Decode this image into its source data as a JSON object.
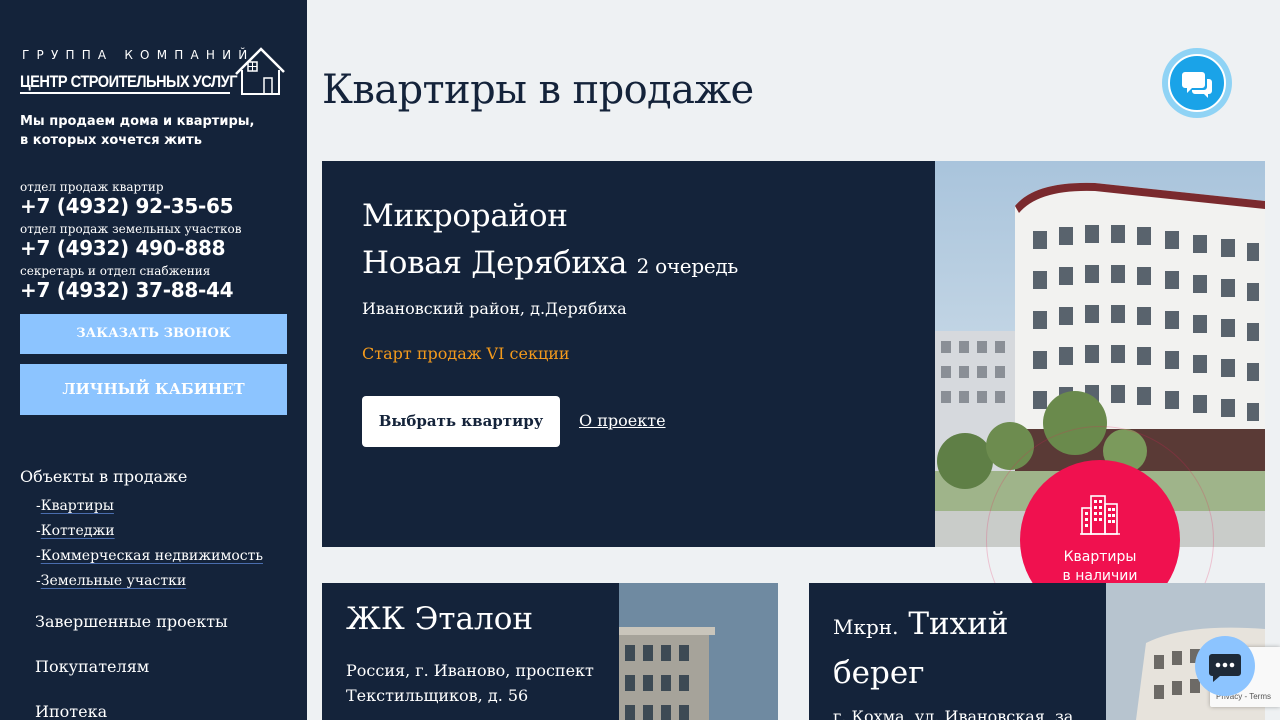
{
  "sidebar": {
    "logo": {
      "line1": "ГРУППА КОМПАНИЙ",
      "line2": "ЦЕНТР СТРОИТЕЛЬНЫХ УСЛУГ",
      "icon": "house-icon"
    },
    "tagline": {
      "line1": "Мы продаем дома и квартиры,",
      "line2": "в которых хочется жить"
    },
    "contacts": [
      {
        "label": "отдел продаж квартир",
        "phone": "+7 (4932) 92-35-65"
      },
      {
        "label": "отдел продаж земельных участков",
        "phone": "+7 (4932) 490-888"
      },
      {
        "label": "секретарь и отдел снабжения",
        "phone": "+7 (4932) 37-88-44"
      }
    ],
    "buttons": {
      "callback": "Заказать звонок",
      "cabinet": "Личный кабинет"
    },
    "nav": {
      "heading": "Объекты в продаже",
      "sub": [
        {
          "label": "Квартиры"
        },
        {
          "label": "Коттеджи"
        },
        {
          "label": "Коммерческая недвижимость"
        },
        {
          "label": "Земельные участки"
        }
      ],
      "main": [
        "Завершенные проекты",
        "Покупателям",
        "Ипотека"
      ]
    }
  },
  "main": {
    "title": "Квартиры в продаже",
    "hero": {
      "title_line1": "Микрорайон",
      "title_line2": "Новая Дерябиха",
      "title_suffix": "2 очередь",
      "address": "Ивановский район, д.Дерябиха",
      "promo": "Старт продаж VI секции",
      "choose_button": "Выбрать квартиру",
      "about_link": "О проекте"
    },
    "badge": {
      "line1": "Квартиры",
      "line2": "в наличии"
    },
    "cards": [
      {
        "title": "ЖК Эталон",
        "address_line1": "Россия, г. Иваново, проспект",
        "address_line2": "Текстильщиков, д. 56"
      },
      {
        "prefix": "Мкрн.",
        "title_word1": "Тихий",
        "title_word2": "берег",
        "address_line1": "г. Кохма, ул. Ивановская, за"
      }
    ],
    "recaptcha": {
      "privacy": "Privacy",
      "terms": "Terms"
    }
  },
  "colors": {
    "navy": "#14233a",
    "accent_blue": "#8cc4ff",
    "badge_red": "#f0114f",
    "promo_orange": "#f39a1c",
    "chat_blue": "#1aa3e8"
  }
}
